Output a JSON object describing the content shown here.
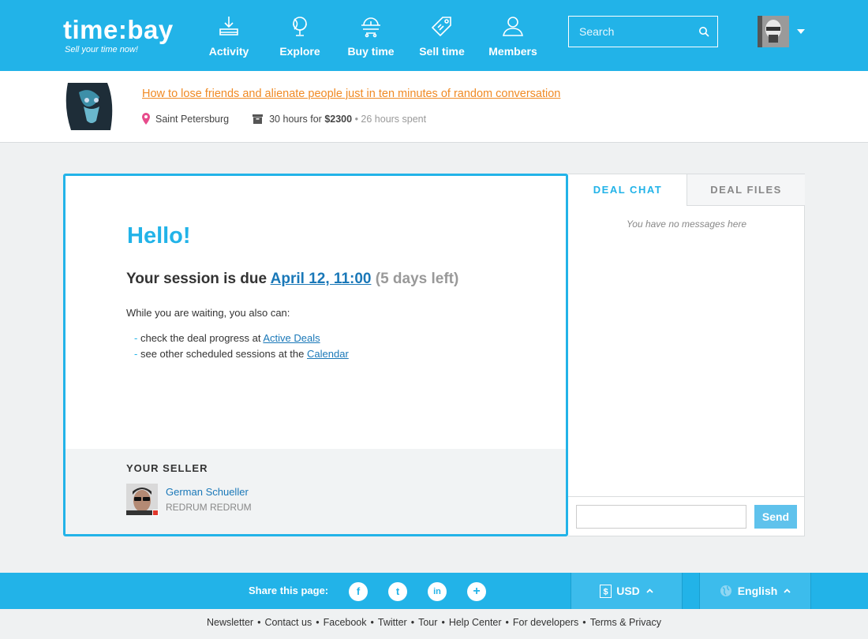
{
  "header": {
    "logo": "time:bay",
    "tagline": "Sell your time now!",
    "nav": [
      {
        "label": "Activity",
        "icon": "activity-icon"
      },
      {
        "label": "Explore",
        "icon": "globe-icon"
      },
      {
        "label": "Buy time",
        "icon": "cart-icon"
      },
      {
        "label": "Sell time",
        "icon": "tag-icon"
      },
      {
        "label": "Members",
        "icon": "user-icon"
      }
    ],
    "search_placeholder": "Search"
  },
  "deal": {
    "title": "How to lose friends and alienate people just in ten minutes of random conversation",
    "location": "Saint Petersburg",
    "hours_price": "30 hours for",
    "price": "$2300",
    "spent": "• 26 hours spent"
  },
  "main": {
    "greeting": "Hello!",
    "due_prefix": "Your session is due",
    "due_date": "April 12, 11:00",
    "due_left": "(5 days left)",
    "waiting": "While you are waiting, you also can:",
    "todo1_prefix": "check the deal progress at",
    "todo1_link": "Active Deals",
    "todo2_prefix": "see other scheduled sessions at the",
    "todo2_link": "Calendar",
    "seller_heading": "YOUR SELLER",
    "seller_name": "German Schueller",
    "seller_sub": "REDRUM REDRUM"
  },
  "chat": {
    "tab_chat": "DEAL CHAT",
    "tab_files": "DEAL FILES",
    "empty": "You have no messages here",
    "send": "Send"
  },
  "footer": {
    "share_label": "Share this page:",
    "social": [
      "f",
      "t",
      "in",
      "+"
    ],
    "currency": "USD",
    "language": "English",
    "links": [
      "Newsletter",
      "Contact us",
      "Facebook",
      "Twitter",
      "Tour",
      "Help Center",
      "For developers",
      "Terms & Privacy"
    ]
  },
  "colors": {
    "accent": "#22b3e8",
    "link": "#1a78b8",
    "deal_title": "#f08a24"
  }
}
